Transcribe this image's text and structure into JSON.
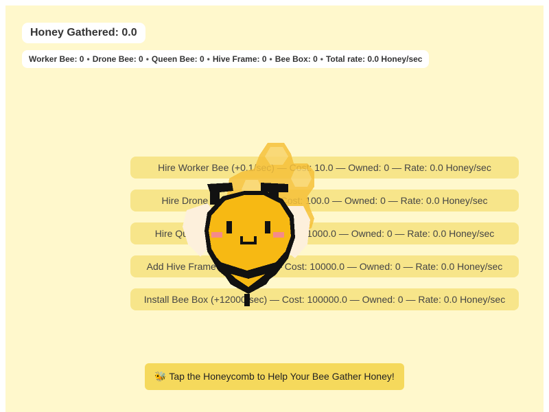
{
  "header": {
    "honey_gathered": "Honey Gathered: 0.0"
  },
  "stats": {
    "worker": "Worker Bee: 0",
    "drone": "Drone Bee: 0",
    "queen": "Queen Bee: 0",
    "frame": "Hive Frame: 0",
    "box": "Bee Box: 0",
    "rate": "Total rate: 0.0 Honey/sec",
    "separator": "•"
  },
  "shop": {
    "worker_label": "Hire Worker Bee (+0.1/sec) — Cost: 10.0 — Owned: 0 — Rate: 0.0 Honey/sec",
    "drone_label": "Hire Drone Bee (+1/sec) — Cost: 100.0 — Owned: 0 — Rate: 0.0 Honey/sec",
    "queen_label": "Hire Queen Bee (+80/sec) — Cost: 1000.0 — Owned: 0 — Rate: 0.0 Honey/sec",
    "frame_label": "Add Hive Frame (+1000/sec) — Cost: 10000.0 — Owned: 0 — Rate: 0.0 Honey/sec",
    "box_label": "Install Bee Box (+12000/sec) — Cost: 100000.0 — Owned: 0 — Rate: 0.0 Honey/sec"
  },
  "tap_button": {
    "label": "🐝 Tap the Honeycomb to Help Your Bee Gather Honey!"
  },
  "colors": {
    "background": "#fff8cc",
    "shop_button": "#f7e58a",
    "tap_button": "#f5d95c",
    "bee_yellow": "#f7b913",
    "bee_black": "#111111",
    "wing": "#fdf0dc",
    "blush": "#f58a8a"
  }
}
